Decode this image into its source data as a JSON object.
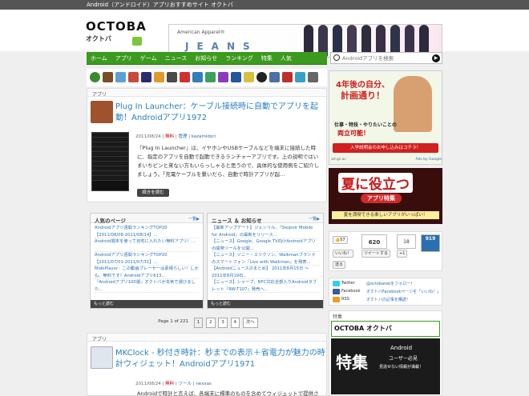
{
  "topbar": {
    "text": "Android（アンドロイド）アプリおすすめサイト オクトバ"
  },
  "logo": {
    "en": "OCTOBA",
    "jp": "オクトバ"
  },
  "banner": {
    "brand": "American Apparel®",
    "word": "JEANS"
  },
  "nav": {
    "items": [
      "ホーム",
      "アプリ",
      "ゲーム",
      "ニュース",
      "お知らせ",
      "ランキング",
      "特集",
      "人気"
    ]
  },
  "search": {
    "placeholder": "Androidアプリを検索"
  },
  "post1": {
    "category": "アプリ",
    "title": "Plug In Launcher：ケーブル接続時に自動でアプリを起動！Androidアプリ1972",
    "date": "2011/08/24",
    "free": "無料",
    "cat": "管理",
    "author": "kazamidori",
    "excerpt": "『Plug In Launcher』は、イヤホンやUSBケーブルなどを端末に接続した時に、指定のアプリを自動で起動できるランチャーアプリです。上の説明ではいまいちピンと来ない方もいらっしゃると思うので、具体的な使用例をご紹介しましょう。「充電ケーブルを繋いだら、自動で時計アプリが起…",
    "more": "続きを読む"
  },
  "popular": {
    "title": "人気のページ",
    "more": "一覧▶",
    "items": [
      "Androidアプリ週間ランキングTOP20 【2011/08/08-2011/08/14】...",
      "Android端末を使って自宅に入れたい無料アプリ！...",
      "Androidアプリ週間ランキングTOP20 【2011/07/01-2011/07/31】...",
      "MobiPlayer：この動画プレーヤーは素晴らしい！しかも、無料です！Androidアプリ613...",
      "『Androidアプリ100選』オクトバが本気で選びました..."
    ],
    "foot": "もっと読む"
  },
  "news": {
    "title": "ニュース ＆ お知らせ",
    "more": "一覧▶",
    "items": [
      "【最新アップデート】ジェンリル、『Sleipnir Mobile for Android』の最新をリリース...",
      "【ニュース】Google、Google TV向けAndroidアプリの開発ツールを公開...",
      "【ニュース】ソニー・エリクソン、Walkmanブランドのスマートフォン「Live with Walkman」を発表...",
      "【Androidニュースのまとめ】 2011年8月15日 ～ 2011年8月19日...",
      "【ニュース】シャープ、NFC対応全部入りAndroidタブレット「RW-T107」発売へ..."
    ],
    "foot": "もっと読む"
  },
  "pager": {
    "info": "Page 1 of 221",
    "pages": [
      "1",
      "2",
      "3",
      "4"
    ],
    "next": "次へ"
  },
  "post2": {
    "category": "アプリ",
    "title": "MKClock - 秒付き時計：秒までの表示＋省電力が魅力の時計ウィジェット！Androidアプリ1971",
    "date": "2011/08/24",
    "free": "無料",
    "cat": "ツール",
    "author": "nexxas",
    "excerpt": "Androidで時計と言えば、各端末に標準のものを含めてウィジェットで提供され"
  },
  "ad1": {
    "headline1": "4年後の自分、",
    "headline2": "計画通り！",
    "sub1": "仕事・特技・やりたいことの",
    "sub2": "両立可能！",
    "cta": "入学説明会のお申し込みはコチラ！",
    "small": "ad.gs.ac",
    "link": "Ads by Google"
  },
  "ad2": {
    "big": "夏に役立つ",
    "tag": "アプリ特集",
    "sub": "夏を満喫できる楽しいアプリがいっぱい！"
  },
  "social": {
    "like": "57",
    "tweets": "620",
    "hatena": "18",
    "gplus": "919",
    "like_label": "いいね！",
    "tweet_label": "ツイートする",
    "gplus_label": "+1",
    "send_label": "送る"
  },
  "follow": {
    "rows": [
      {
        "label": "Twitter",
        "link": "@octobanetをフォロー！"
      },
      {
        "label": "Facebook",
        "link": "オクトバFacebookページを「いいね！」"
      },
      {
        "label": "RSS",
        "link": "オクトバの記事を購読！"
      }
    ]
  },
  "tokushu": {
    "label": "特集",
    "brand": "OCTOBA オクトバ",
    "big": "特集",
    "sub1": "Android",
    "sub2": "ユーザー必見",
    "sub3": "見逃せない情報が満載！"
  }
}
